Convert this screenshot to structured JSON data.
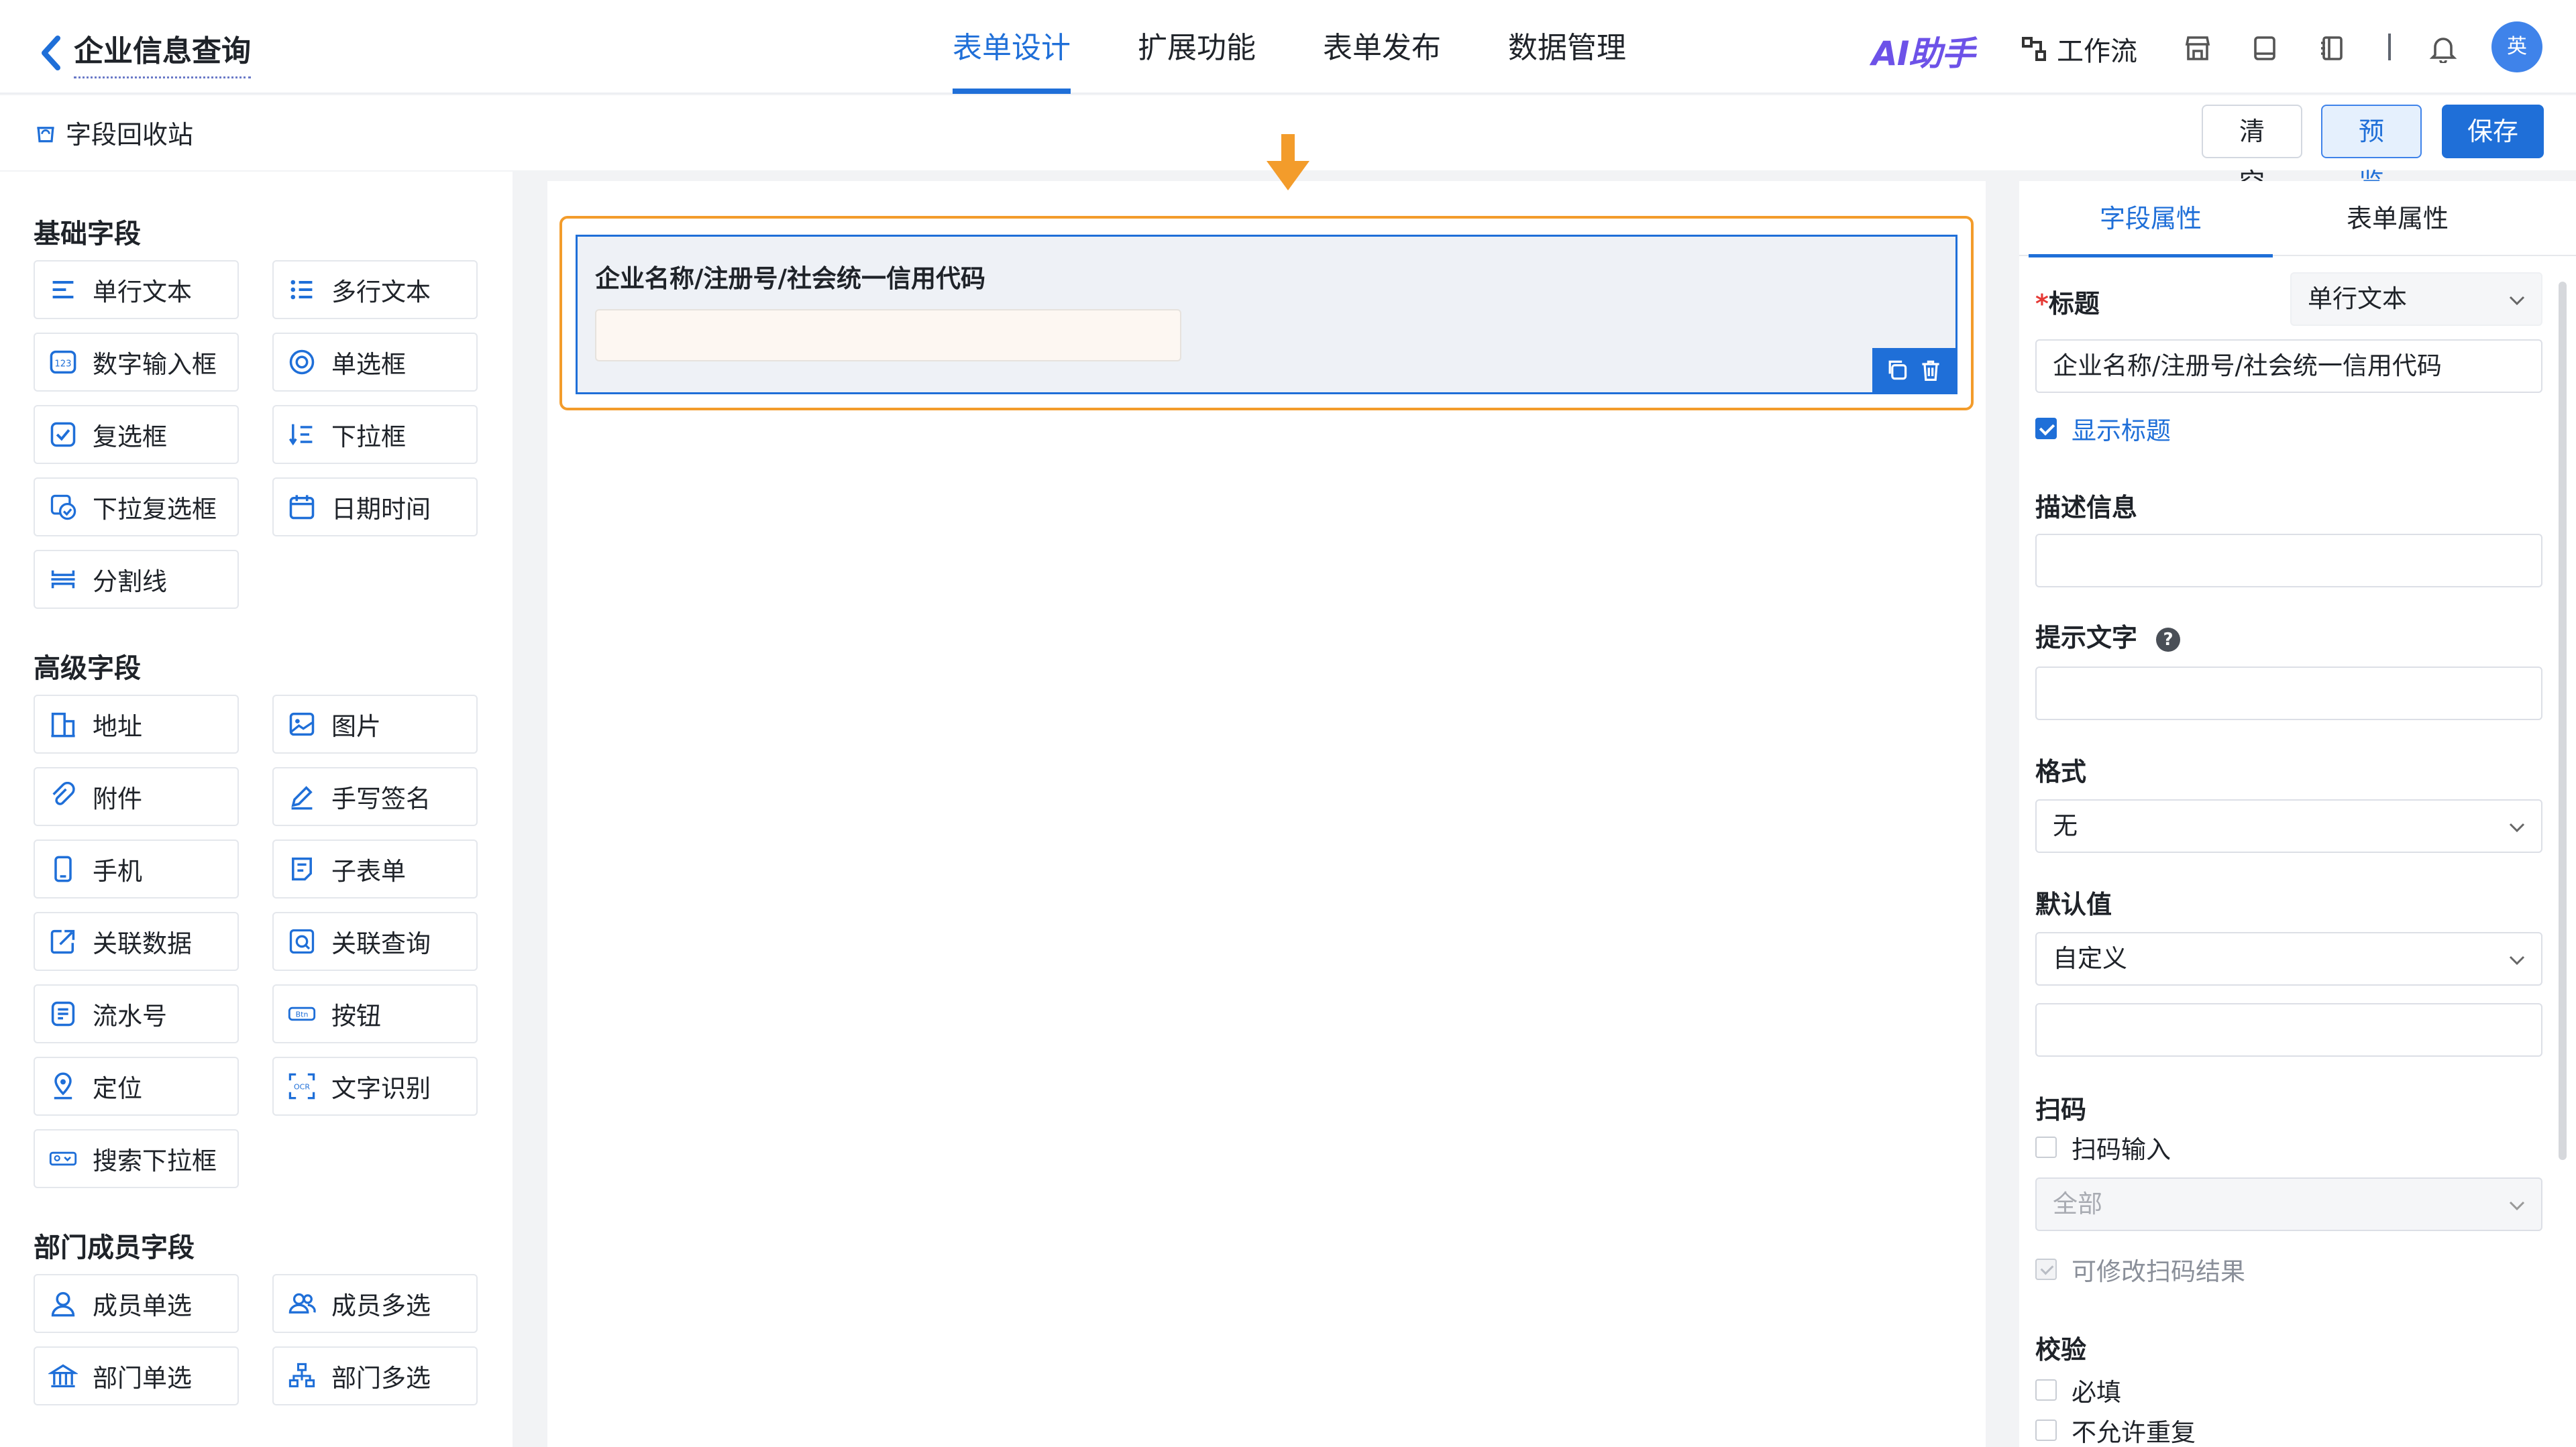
{
  "header": {
    "back_label": "企业信息查询",
    "nav_tabs": [
      "表单设计",
      "扩展功能",
      "表单发布",
      "数据管理"
    ],
    "active_tab": "表单设计",
    "ai_label": "AI助手",
    "workflow_label": "工作流",
    "avatar_text": "英"
  },
  "subbar": {
    "recycle_label": "字段回收站",
    "clear_label": "清空",
    "preview_label": "预览",
    "save_label": "保存"
  },
  "left_panel": {
    "groups": [
      {
        "title": "基础字段",
        "items": [
          {
            "label": "单行文本",
            "icon": "single-line-text-icon"
          },
          {
            "label": "多行文本",
            "icon": "multi-line-text-icon"
          },
          {
            "label": "数字输入框",
            "icon": "number-input-icon"
          },
          {
            "label": "单选框",
            "icon": "radio-icon"
          },
          {
            "label": "复选框",
            "icon": "checkbox-icon"
          },
          {
            "label": "下拉框",
            "icon": "dropdown-icon"
          },
          {
            "label": "下拉复选框",
            "icon": "dropdown-checkbox-icon"
          },
          {
            "label": "日期时间",
            "icon": "calendar-icon"
          },
          {
            "label": "分割线",
            "icon": "divider-icon"
          }
        ]
      },
      {
        "title": "高级字段",
        "items": [
          {
            "label": "地址",
            "icon": "building-icon"
          },
          {
            "label": "图片",
            "icon": "image-icon"
          },
          {
            "label": "附件",
            "icon": "paperclip-icon"
          },
          {
            "label": "手写签名",
            "icon": "pen-icon"
          },
          {
            "label": "手机",
            "icon": "phone-icon"
          },
          {
            "label": "子表单",
            "icon": "subform-icon"
          },
          {
            "label": "关联数据",
            "icon": "linked-data-icon"
          },
          {
            "label": "关联查询",
            "icon": "linked-query-icon"
          },
          {
            "label": "流水号",
            "icon": "serial-number-icon"
          },
          {
            "label": "按钮",
            "icon": "button-icon"
          },
          {
            "label": "定位",
            "icon": "location-icon"
          },
          {
            "label": "文字识别",
            "icon": "ocr-icon"
          },
          {
            "label": "搜索下拉框",
            "icon": "search-dropdown-icon"
          }
        ]
      },
      {
        "title": "部门成员字段",
        "items": [
          {
            "label": "成员单选",
            "icon": "user-icon"
          },
          {
            "label": "成员多选",
            "icon": "users-icon"
          },
          {
            "label": "部门单选",
            "icon": "department-icon"
          },
          {
            "label": "部门多选",
            "icon": "org-chart-icon"
          }
        ]
      }
    ]
  },
  "canvas": {
    "field_label": "企业名称/注册号/社会统一信用代码",
    "field_value": ""
  },
  "right_panel": {
    "tabs": [
      "字段属性",
      "表单属性"
    ],
    "active_tab": "字段属性",
    "title_label": "标题",
    "title_required_mark": "*",
    "field_type": "单行文本",
    "title_value": "企业名称/注册号/社会统一信用代码",
    "show_title_label": "显示标题",
    "show_title_checked": true,
    "description_label": "描述信息",
    "description_value": "",
    "placeholder_label": "提示文字",
    "placeholder_help": "?",
    "placeholder_value": "",
    "format_label": "格式",
    "format_value": "无",
    "default_label": "默认值",
    "default_mode": "自定义",
    "default_value": "",
    "scan_label": "扫码",
    "scan_input_label": "扫码输入",
    "scan_input_checked": false,
    "scan_scope": "全部",
    "scan_editable_label": "可修改扫码结果",
    "scan_editable_checked": true,
    "validation_label": "校验",
    "required_label": "必填",
    "required_checked": false,
    "no_duplicate_label": "不允许重复"
  },
  "colors": {
    "primary": "#1f6fd8",
    "highlight_border": "#f39c2b",
    "ai_purple": "#6d52e8"
  }
}
